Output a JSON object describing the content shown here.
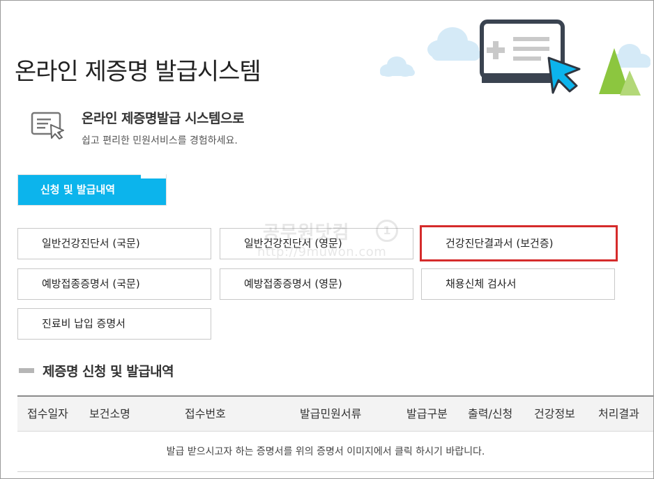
{
  "page": {
    "title": "온라인 제증명 발급시스템"
  },
  "intro": {
    "title": "온라인 제증명발급 시스템으로",
    "subtitle": "쉽고 편리한 민원서비스를 경험하세요."
  },
  "apply_button": {
    "label": "신청 및 발급내역"
  },
  "certificates": [
    {
      "label": "일반건강진단서 (국문)"
    },
    {
      "label": "일반건강진단서 (영문)"
    },
    {
      "label": "건강진단결과서 (보건증)",
      "highlighted": true
    },
    {
      "label": "예방접종증명서 (국문)"
    },
    {
      "label": "예방접종증명서 (영문)"
    },
    {
      "label": "채용신체 검사서"
    },
    {
      "label": "진료비 납입 증명서"
    }
  ],
  "watermark": {
    "line1": "공무원닷컴",
    "line2": "http://9muwon.com",
    "badge": "1"
  },
  "history": {
    "title": "제증명 신청 및 발급내역",
    "columns": [
      "접수일자",
      "보건소명",
      "접수번호",
      "발급민원서류",
      "발급구분",
      "출력/신청",
      "건강정보",
      "처리결과"
    ],
    "empty_message": "발급 받으시고자 하는 증명서를 위의 증명서 이미지에서 클릭 하시기 바랍니다."
  },
  "colors": {
    "accent": "#0cb4ec",
    "highlight_border": "#d52b2b",
    "tree": "#8cc63f",
    "cloud": "#d5eaf7"
  }
}
